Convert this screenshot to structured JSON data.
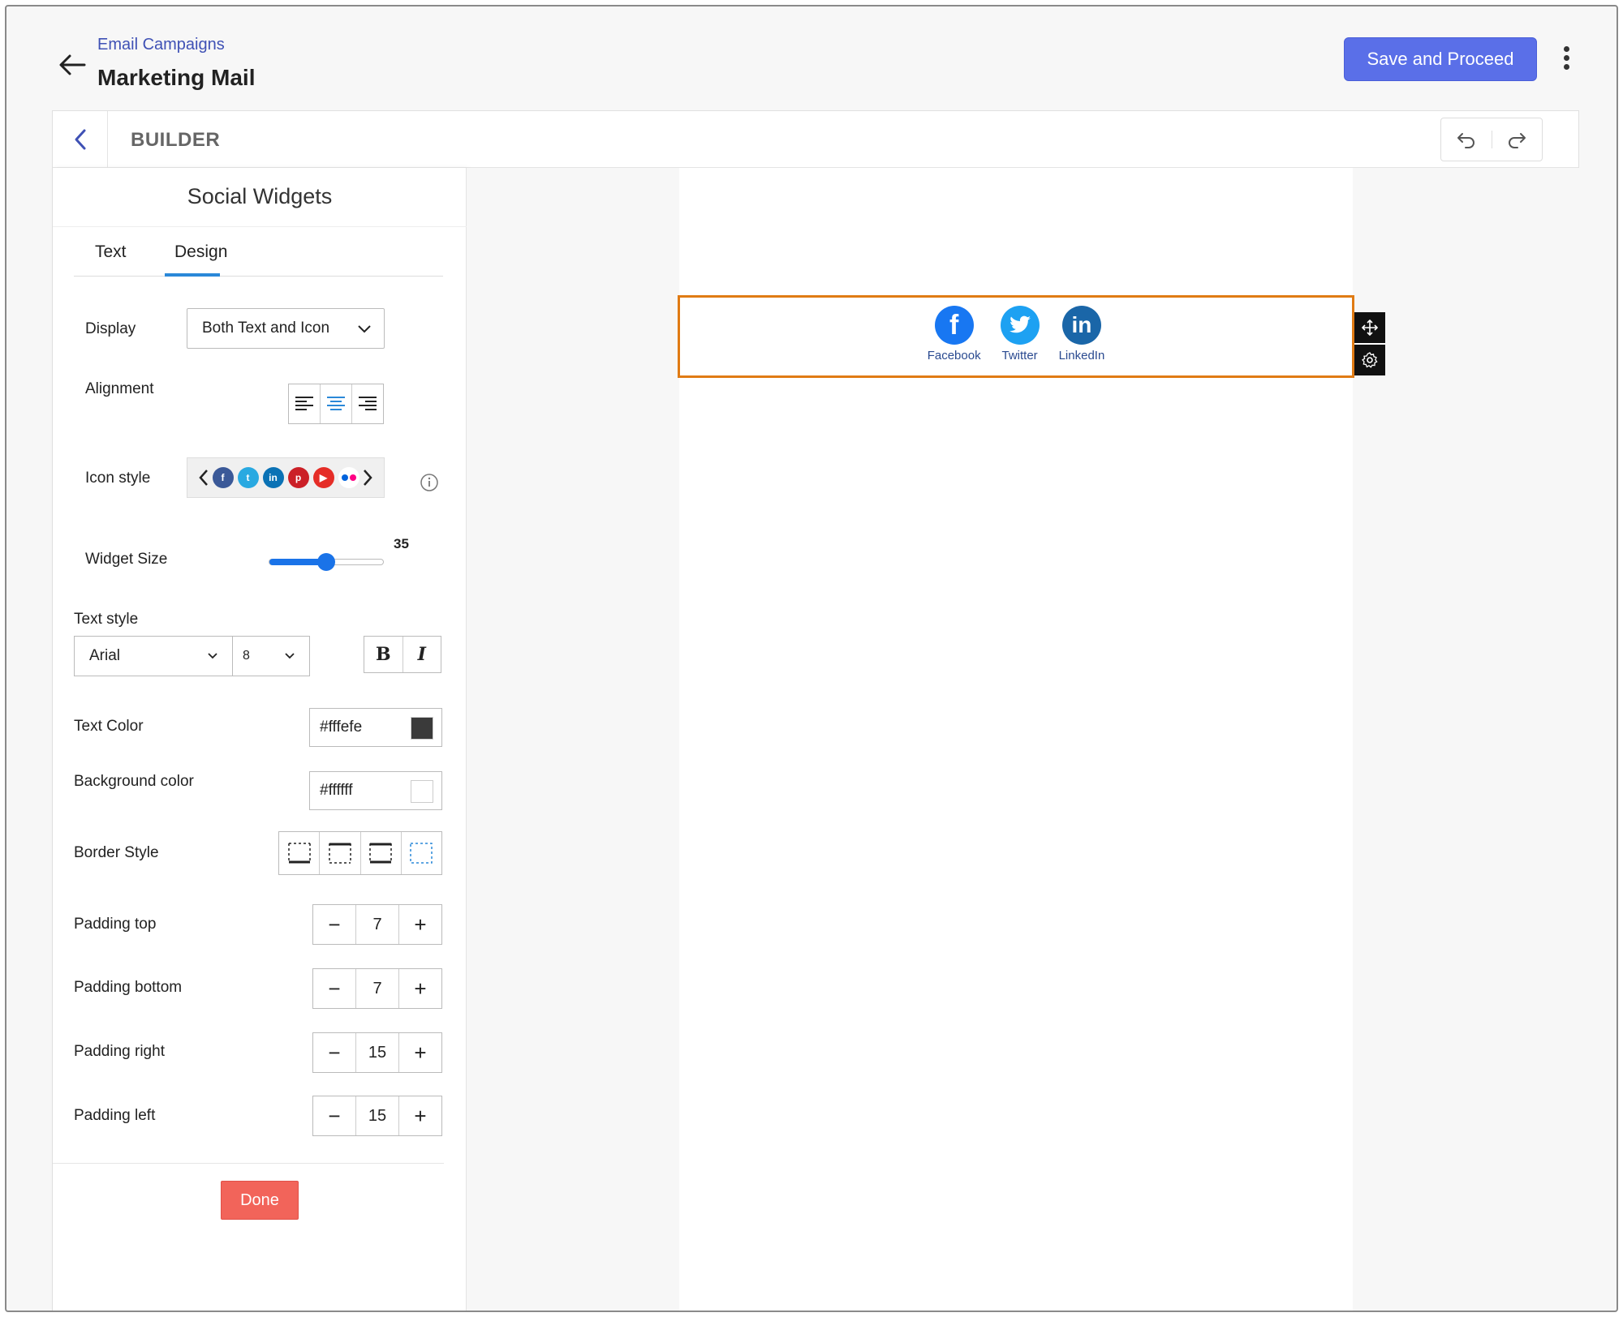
{
  "header": {
    "breadcrumb": "Email Campaigns",
    "title": "Marketing Mail",
    "save_label": "Save and Proceed"
  },
  "builder": {
    "title": "BUILDER"
  },
  "panel": {
    "title": "Social Widgets",
    "tabs": [
      {
        "label": "Text",
        "active": false
      },
      {
        "label": "Design",
        "active": true
      }
    ],
    "display": {
      "label": "Display",
      "value": "Both Text and Icon"
    },
    "alignment": {
      "label": "Alignment",
      "selected": "center"
    },
    "icon_style": {
      "label": "Icon style",
      "icons": [
        "facebook-icon",
        "twitter-icon",
        "linkedin-icon",
        "pinterest-icon",
        "youtube-icon",
        "flickr-icon"
      ]
    },
    "widget_size": {
      "label": "Widget Size",
      "value": "35",
      "fraction": 0.5
    },
    "text_style": {
      "label": "Text style",
      "font": "Arial",
      "size": "8",
      "bold": "B",
      "italic": "I"
    },
    "text_color": {
      "label": "Text Color",
      "value": "#fffefe",
      "swatch": "#3a3a3a"
    },
    "background_color": {
      "label": "Background color",
      "value": "#ffffff",
      "swatch": "#ffffff"
    },
    "border_style": {
      "label": "Border Style",
      "selected": 3
    },
    "padding": [
      {
        "label": "Padding top",
        "value": "7"
      },
      {
        "label": "Padding bottom",
        "value": "7"
      },
      {
        "label": "Padding right",
        "value": "15"
      },
      {
        "label": "Padding left",
        "value": "15"
      }
    ],
    "done_label": "Done"
  },
  "canvas": {
    "social": [
      {
        "name": "facebook",
        "label": "Facebook",
        "color": "#1877f2"
      },
      {
        "name": "twitter",
        "label": "Twitter",
        "color": "#1da1f2"
      },
      {
        "name": "linkedin",
        "label": "LinkedIn",
        "color": "#1a66a8"
      }
    ],
    "highlight_color": "#e07b14"
  },
  "colors": {
    "accent": "#5a6fe8",
    "done": "#f2645a",
    "tab_active": "#2a88d8",
    "slider": "#1a73e8"
  }
}
